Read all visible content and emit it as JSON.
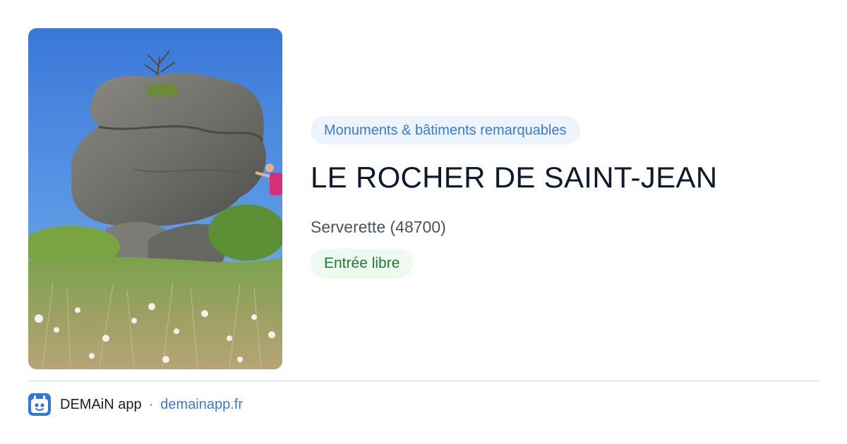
{
  "place": {
    "category": "Monuments & bâtiments remarquables",
    "title": "LE ROCHER DE SAINT-JEAN",
    "location": "Serverette (48700)",
    "access": "Entrée libre"
  },
  "footer": {
    "app_name": "DEMAiN app",
    "separator": "·",
    "site": "demainapp.fr"
  },
  "colors": {
    "accent": "#3b7ad4",
    "category_bg": "#eef4fd",
    "access_text": "#1f7a35",
    "access_bg": "#eef9f0",
    "title": "#0d1a2e"
  },
  "icons": {
    "app_logo": "demain-app-icon"
  }
}
